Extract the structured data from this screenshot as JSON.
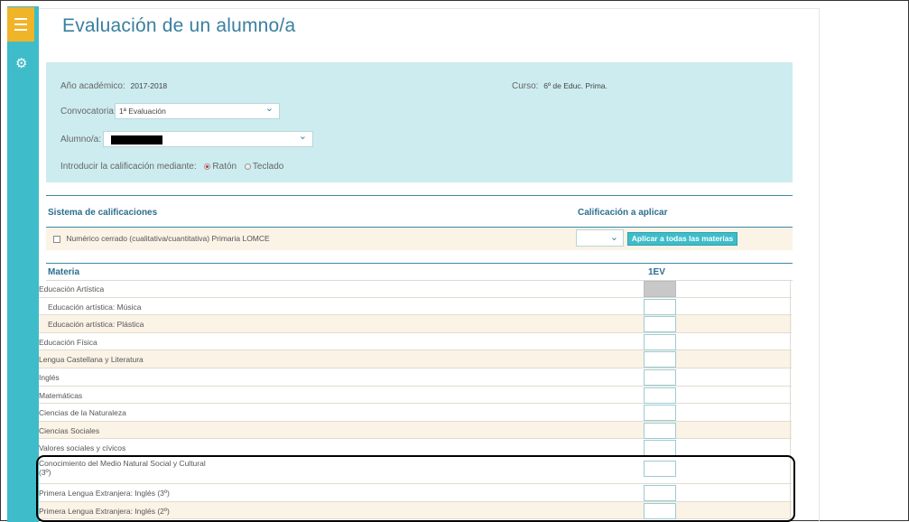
{
  "page": {
    "title": "Evaluación de un alumno/a"
  },
  "filters": {
    "year_label": "Año académico:",
    "year_value": "2017-2018",
    "course_label": "Curso:",
    "course_value": "6º de Educ. Prima.",
    "convocatoria_label": "Convocatoria:",
    "convocatoria_value": "1ª Evaluación",
    "alumno_label": "Alumno/a:",
    "input_mode_label": "Introducir la calificación mediante:",
    "option_mouse": "Ratón",
    "option_keyboard": "Teclado",
    "selected_option": "Ratón"
  },
  "grading": {
    "system_header": "Sistema de calificaciones",
    "apply_header": "Calificación a aplicar",
    "system_name": "Numérico cerrado (cualitativa/cuantitativa) Primaria LOMCE",
    "apply_button": "Aplicar a todas las materias"
  },
  "subjects": {
    "col_subject": "Materia",
    "col_period": "1EV",
    "rows": [
      {
        "name": "Educación Artística"
      },
      {
        "name": "Educación artística: Música"
      },
      {
        "name": "Educación artística: Plástica"
      },
      {
        "name": "Educación Física"
      },
      {
        "name": "Lengua Castellana y Literatura"
      },
      {
        "name": "Inglés"
      },
      {
        "name": "Matemáticas"
      },
      {
        "name": "Ciencias de la Naturaleza"
      },
      {
        "name": "Ciencias Sociales"
      },
      {
        "name": "Valores sociales y cívicos"
      },
      {
        "name": "Conocimiento del Medio Natural Social y Cultural (3º)"
      },
      {
        "name": "Primera Lengua Extranjera: Inglés (3º)"
      },
      {
        "name": "Primera Lengua Extranjera: Inglés (2º)"
      }
    ]
  },
  "icons": {
    "menu": "hamburger-icon",
    "settings": "gear-icon",
    "dropdown": "chevron-down-icon"
  },
  "colors": {
    "sidebar": "#3ebcc9",
    "menu_tab": "#f0b429",
    "filter_bg": "#cdecef",
    "title": "#3a7fa0"
  }
}
